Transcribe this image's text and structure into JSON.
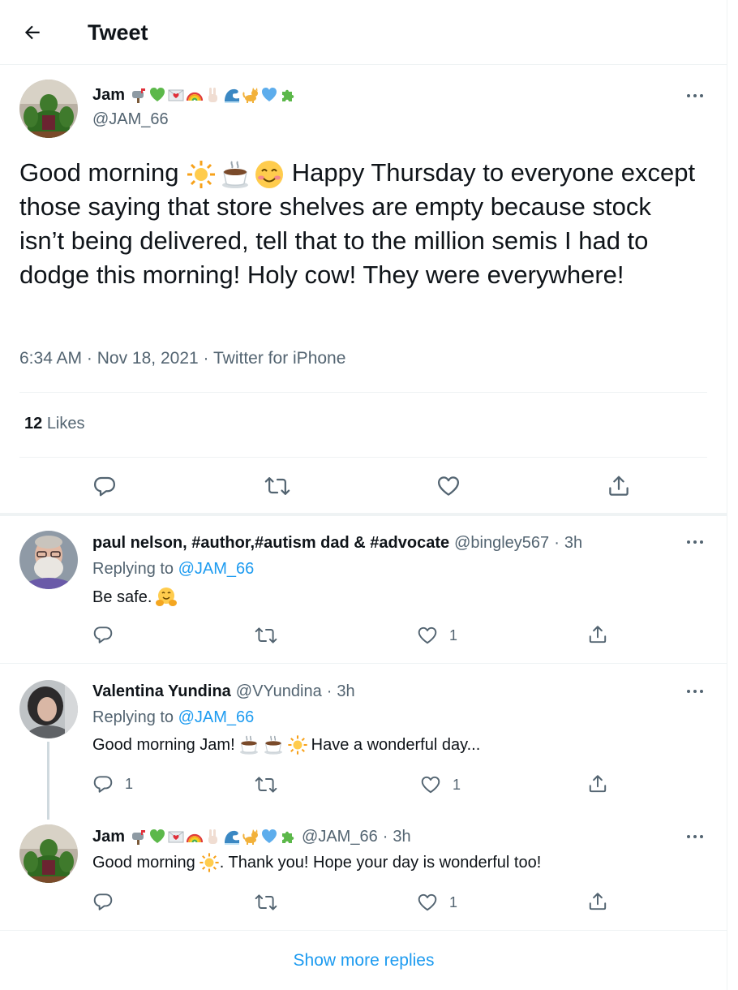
{
  "header": {
    "title": "Tweet"
  },
  "main_tweet": {
    "author_name": "Jam",
    "author_emojis": [
      "mailbox-icon",
      "green-heart-icon",
      "love-letter-icon",
      "rainbow-icon",
      "victory-hand-icon",
      "wave-icon",
      "cat-icon",
      "blue-heart-icon",
      "puzzle-icon"
    ],
    "handle": "@JAM_66",
    "text_part1": "Good morning",
    "text_part2": "Happy Thursday to everyone except those saying that store shelves are empty because stock isn’t being delivered, tell that to the million semis I had to dodge this morning!  Holy cow! They were everywhere!",
    "time": "6:34 AM",
    "date": "Nov 18, 2021",
    "source": "Twitter for iPhone",
    "likes_count": "12",
    "likes_label": "Likes"
  },
  "replies": [
    {
      "name": "paul nelson, #author,#autism dad & #advocate",
      "handle": "@bingley567",
      "time": "3h",
      "replying_label": "Replying to",
      "replying_handle": "@JAM_66",
      "text": "Be safe.",
      "reply_count": "",
      "like_count": "1"
    },
    {
      "name": "Valentina Yundina",
      "handle": "@VYundina",
      "time": "3h",
      "replying_label": "Replying to",
      "replying_handle": "@JAM_66",
      "text_part1": "Good morning Jam!",
      "text_part2": "Have a wonderful day...",
      "reply_count": "1",
      "like_count": "1"
    },
    {
      "name": "Jam",
      "handle": "@JAM_66",
      "time": "3h",
      "text_part1": "Good morning",
      "text_part2": ". Thank you! Hope your day is wonderful too!",
      "reply_count": "",
      "like_count": "1"
    }
  ],
  "meta_sep": "·",
  "show_more": "Show more replies",
  "colors": {
    "accent": "#1d9bf0",
    "text": "#0f1419",
    "muted": "#536471",
    "border": "#eff3f4"
  }
}
